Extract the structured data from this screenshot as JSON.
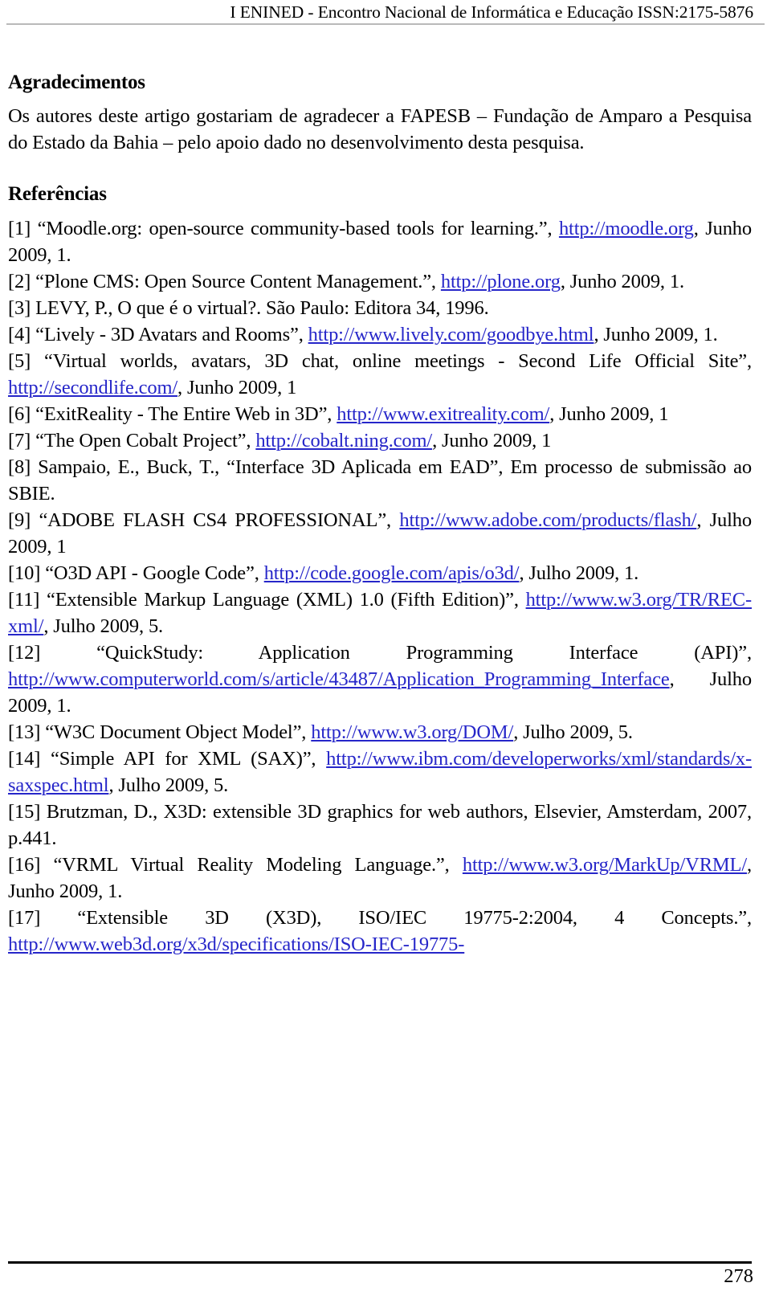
{
  "header": {
    "running_title": "I ENINED - Encontro Nacional de Informática e Educação ISSN:2175-5876"
  },
  "acknowledgements": {
    "heading": "Agradecimentos",
    "body": "Os autores deste artigo gostariam de agradecer a FAPESB – Fundação de Amparo a Pesquisa do Estado da Bahia – pelo apoio dado no desenvolvimento desta pesquisa."
  },
  "references": {
    "heading": "Referências",
    "items": [
      {
        "label": "[1]",
        "pre": "[1] “Moodle.org: open-source community-based tools for learning.”, ",
        "link": "http://moodle.org",
        "post": ", Junho 2009, 1."
      },
      {
        "label": "[2]",
        "pre": "[2] “Plone CMS: Open Source Content Management.”, ",
        "link": "http://plone.org",
        "post": ", Junho 2009, 1."
      },
      {
        "label": "[3]",
        "pre": "[3] LEVY, P., O que é o virtual?. São Paulo: Editora 34, 1996.",
        "link": "",
        "post": ""
      },
      {
        "label": "[4]",
        "pre": "[4] “Lively - 3D Avatars and Rooms”, ",
        "link": "http://www.lively.com/goodbye.html",
        "post": ", Junho 2009, 1."
      },
      {
        "label": "[5]",
        "pre": "[5] “Virtual worlds, avatars, 3D chat, online meetings - Second Life Official Site”, ",
        "link": "http://secondlife.com/",
        "post": ", Junho 2009, 1"
      },
      {
        "label": "[6]",
        "pre": "[6] “ExitReality - The Entire Web in 3D”, ",
        "link": "http://www.exitreality.com/",
        "post": ", Junho 2009, 1"
      },
      {
        "label": "[7]",
        "pre": "[7] “The Open Cobalt Project”, ",
        "link": "http://cobalt.ning.com/",
        "post": ", Junho 2009, 1"
      },
      {
        "label": "[8]",
        "pre": "[8] Sampaio, E., Buck, T., “Interface 3D Aplicada em EAD”, Em processo de submissão ao SBIE.",
        "link": "",
        "post": ""
      },
      {
        "label": "[9]",
        "pre": "[9] “ADOBE FLASH CS4 PROFESSIONAL”, ",
        "link": "http://www.adobe.com/products/flash/",
        "post": ", Julho 2009, 1"
      },
      {
        "label": "[10]",
        "pre": "[10] “O3D API - Google Code”, ",
        "link": "http://code.google.com/apis/o3d/",
        "post": ", Julho 2009, 1."
      },
      {
        "label": "[11]",
        "pre": "[11] “Extensible Markup Language (XML) 1.0 (Fifth Edition)”, ",
        "link": "http://www.w3.org/TR/REC-xml/",
        "post": ", Julho 2009, 5."
      },
      {
        "label": "[12]",
        "pre": "[12] “QuickStudy: Application Programming Interface (API)”, ",
        "link": "http://www.computerworld.com/s/article/43487/Application_Programming_Interface",
        "post": ", Julho 2009, 1."
      },
      {
        "label": "[13]",
        "pre": "[13] “W3C Document Object Model”, ",
        "link": "http://www.w3.org/DOM/",
        "post": ", Julho 2009, 5."
      },
      {
        "label": "[14]",
        "pre": "[14] “Simple API for XML (SAX)”, ",
        "link": "http://www.ibm.com/developerworks/xml/standards/x-saxspec.html",
        "post": ", Julho 2009, 5."
      },
      {
        "label": "[15]",
        "pre": "[15] Brutzman, D., X3D: extensible 3D graphics for web authors, Elsevier,  Amsterdam, 2007, p.441.",
        "link": "",
        "post": ""
      },
      {
        "label": "[16]",
        "pre": "[16] “VRML Virtual Reality Modeling Language.”, ",
        "link": "http://www.w3.org/MarkUp/VRML/",
        "post": ", Junho 2009, 1."
      },
      {
        "label": "[17]",
        "pre": "[17] “Extensible 3D (X3D), ISO/IEC 19775-2:2004, 4 Concepts.”, ",
        "link": "http://www.web3d.org/x3d/specifications/ISO-IEC-19775-",
        "post": ""
      }
    ]
  },
  "footer": {
    "page_number": "278"
  },
  "colors": {
    "link": "#2626c9",
    "header_rule": "#b9b9b9",
    "footer_rule": "#000000",
    "text": "#000000"
  }
}
